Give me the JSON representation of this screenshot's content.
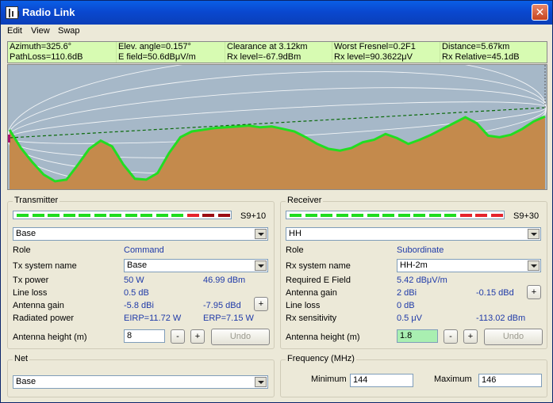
{
  "window": {
    "title": "Radio Link",
    "close_label": "✕"
  },
  "menu": {
    "items": [
      "Edit",
      "View",
      "Swap"
    ]
  },
  "info": {
    "row1": [
      "Azimuth=325.6°",
      "Elev. angle=0.157°",
      "Clearance at 3.12km",
      "Worst Fresnel=0.2F1",
      "Distance=5.67km"
    ],
    "row2": [
      "PathLoss=110.6dB",
      "E field=50.6dBμV/m",
      "Rx level=-67.9dBm",
      "Rx level=90.3622μV",
      "Rx Relative=45.1dB"
    ]
  },
  "profile": {
    "colors": {
      "sky": "#a6b8c8",
      "terrain": "#c48a4c",
      "terrain_edge": "#22dd22",
      "los": "#0a6a0a"
    },
    "terrain_elevations": [
      0.62,
      0.4,
      0.23,
      0.08,
      0.0,
      0.02,
      0.2,
      0.39,
      0.49,
      0.42,
      0.2,
      0.03,
      0.02,
      0.1,
      0.34,
      0.53,
      0.6,
      0.62,
      0.64,
      0.65,
      0.66,
      0.67,
      0.65,
      0.66,
      0.63,
      0.6,
      0.53,
      0.45,
      0.39,
      0.37,
      0.4,
      0.47,
      0.5,
      0.57,
      0.52,
      0.45,
      0.5,
      0.56,
      0.63,
      0.7,
      0.77,
      0.7,
      0.55,
      0.53,
      0.56,
      0.63,
      0.72,
      0.78
    ]
  },
  "transmitter": {
    "title": "Transmitter",
    "meter_label": "S9+10",
    "meter_segments": [
      "#1fdc1f",
      "#1fdc1f",
      "#1fdc1f",
      "#1fdc1f",
      "#1fdc1f",
      "#1fdc1f",
      "#1fdc1f",
      "#1fdc1f",
      "#1fdc1f",
      "#1fdc1f",
      "#1fdc1f",
      "#e5242c",
      "#9a0c14",
      "#9a0c14"
    ],
    "system_select": "Base",
    "role_label": "Role",
    "role_value": "Command",
    "system_name_label": "Tx system name",
    "system_name_value": "Base",
    "power_label": "Tx power",
    "power_w": "50 W",
    "power_dbm": "46.99 dBm",
    "line_loss_label": "Line loss",
    "line_loss_value": "0.5 dB",
    "gain_label": "Antenna gain",
    "gain_dbi": "-5.8 dBi",
    "gain_dbd": "-7.95 dBd",
    "radiated_label": "Radiated power",
    "eirp": "EIRP=11.72 W",
    "erp": "ERP=7.15 W",
    "height_label": "Antenna height (m)",
    "height_value": "8",
    "minus": "-",
    "plus": "+",
    "undo": "Undo"
  },
  "receiver": {
    "title": "Receiver",
    "meter_label": "S9+30",
    "meter_segments": [
      "#1fdc1f",
      "#1fdc1f",
      "#1fdc1f",
      "#1fdc1f",
      "#1fdc1f",
      "#1fdc1f",
      "#1fdc1f",
      "#1fdc1f",
      "#1fdc1f",
      "#1fdc1f",
      "#1fdc1f",
      "#e5242c",
      "#e5242c",
      "#e5242c"
    ],
    "system_select": "HH",
    "role_label": "Role",
    "role_value": "Subordinate",
    "system_name_label": "Rx system name",
    "system_name_value": "HH-2m",
    "efield_label": "Required E Field",
    "efield_value": "5.42 dBμV/m",
    "gain_label": "Antenna gain",
    "gain_dbi": "2 dBi",
    "gain_dbd": "-0.15 dBd",
    "line_loss_label": "Line loss",
    "line_loss_value": "0 dB",
    "sens_label": "Rx sensitivity",
    "sens_uv": "0.5 μV",
    "sens_dbm": "-113.02 dBm",
    "height_label": "Antenna height (m)",
    "height_value": "1.8",
    "minus": "-",
    "plus": "+",
    "undo": "Undo"
  },
  "net": {
    "title": "Net",
    "select": "Base"
  },
  "frequency": {
    "title": "Frequency (MHz)",
    "min_label": "Minimum",
    "min_value": "144",
    "max_label": "Maximum",
    "max_value": "146"
  }
}
